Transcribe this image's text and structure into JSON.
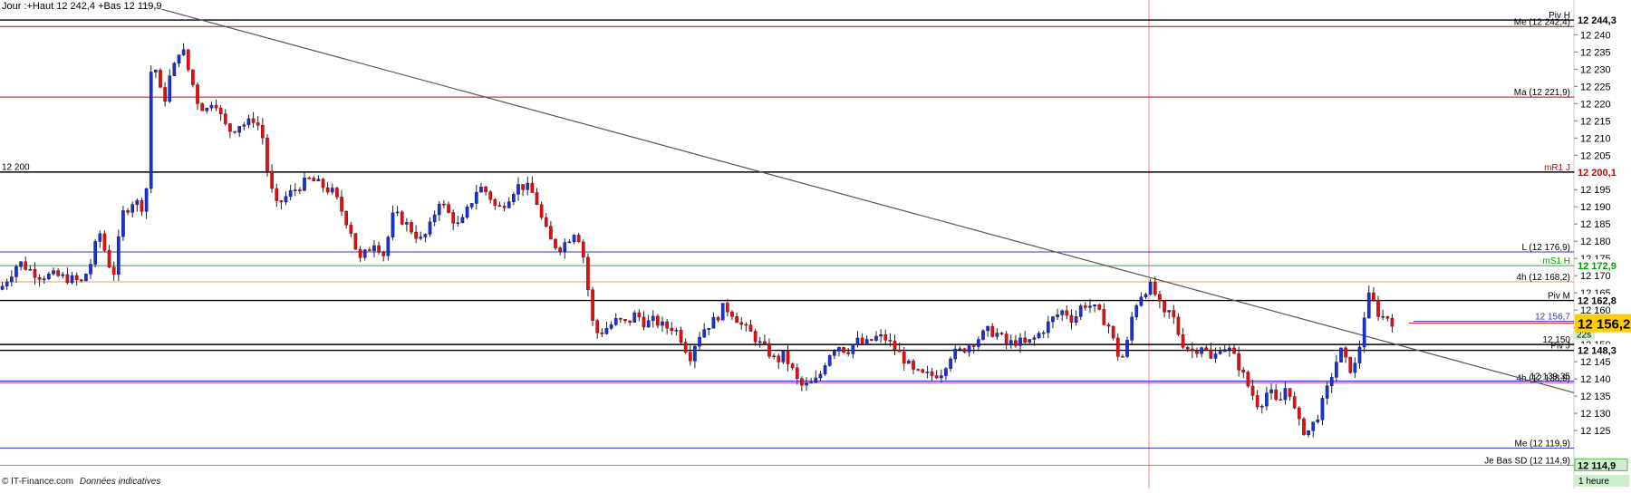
{
  "header": {
    "title": "Jour :+Haut 12 242,4 +Bas 12 119,9"
  },
  "footer": {
    "copyright": "© IT-Finance.com",
    "note": "Données indicatives"
  },
  "chart_data": {
    "type": "candlestick",
    "interval_label": "1 heure",
    "ylim": [
      12110,
      12248
    ],
    "yticks": [
      12125,
      12130,
      12135,
      12140,
      12145,
      12150,
      12155,
      12160,
      12165,
      12170,
      12175,
      12180,
      12185,
      12190,
      12195,
      12200,
      12205,
      12210,
      12215,
      12220,
      12225,
      12230,
      12235,
      12240
    ],
    "current_price": {
      "value": 12156.2,
      "label": "12 156,2"
    },
    "level_lines": [
      {
        "name": "Piv H",
        "value": 12244.3,
        "label": "Piv H",
        "price_label": "12 244,3",
        "color": "#000000",
        "label_color": "#000000",
        "tag_bg": ""
      },
      {
        "name": "Me",
        "value": 12242.4,
        "label": "Me (12 242,4)",
        "price_label": "",
        "color": "#cc0000",
        "label_color": "#000000",
        "tag_bg": ""
      },
      {
        "name": "Ma",
        "value": 12221.9,
        "label": "Ma (12 221,9)",
        "price_label": "",
        "color": "#cc0000",
        "label_color": "#000000",
        "tag_bg": ""
      },
      {
        "name": "mR1 J",
        "value": 12200.1,
        "label": "mR1 J",
        "price_label": "12 200,1",
        "color": "#000000",
        "label_color": "#cc0000",
        "tag_bg": ""
      },
      {
        "name": "L",
        "value": 12176.9,
        "label": "L (12 176,9)",
        "price_label": "",
        "color": "#3333cc",
        "label_color": "#000000",
        "tag_bg": ""
      },
      {
        "name": "mS1 H",
        "value": 12172.9,
        "label": "mS1 H",
        "price_label": "12 172,9",
        "color": "#33aa33",
        "label_color": "#009900",
        "tag_bg": ""
      },
      {
        "name": "4h",
        "value": 12168.2,
        "label": "4h (12 168,2)",
        "price_label": "",
        "color": "#e89a6a",
        "label_color": "#000000",
        "tag_bg": ""
      },
      {
        "name": "Piv M",
        "value": 12162.8,
        "label": "Piv M",
        "price_label": "12 162,8",
        "color": "#000000",
        "label_color": "#000000",
        "tag_bg": ""
      },
      {
        "name": "12 150",
        "value": 12150,
        "label": "12 150",
        "price_label": "",
        "color": "#000000",
        "label_color": "#000000",
        "tag_bg": ""
      },
      {
        "name": "Piv J",
        "value": 12148.3,
        "label": "Piv J",
        "price_label": "12 148,3",
        "color": "#000000",
        "label_color": "#000000",
        "tag_bg": ""
      },
      {
        "name": "12 139,35",
        "value": 12139.35,
        "label": "12 139,35",
        "price_label": "",
        "color": "#3333cc",
        "label_color": "#000000",
        "tag_bg": ""
      },
      {
        "name": "4h low",
        "value": 12138.9,
        "label": "4h (12 138,9)",
        "price_label": "",
        "color": "#cc3399",
        "label_color": "#000000",
        "tag_bg": ""
      },
      {
        "name": "Me low",
        "value": 12119.9,
        "label": "Me (12 119,9)",
        "price_label": "",
        "color": "#3333cc",
        "label_color": "#000000",
        "tag_bg": ""
      },
      {
        "name": "Je Bas SD",
        "value": 12114.9,
        "label": "Je Bas SD (12 114,9)",
        "price_label": "12 114,9",
        "color": "#55bb55",
        "label_color": "#000000",
        "tag_bg": "#cceecc"
      }
    ],
    "extra_labels": [
      {
        "value": 12200.0,
        "label": "12 200"
      },
      {
        "value": 12156.7,
        "label": "12 156,7"
      },
      {
        "value": 12153,
        "label": "22s"
      }
    ],
    "trendline": {
      "from": {
        "x": 0.09,
        "y": 12249
      },
      "to": {
        "x": 1.0,
        "y": 12136
      }
    },
    "crosshair_x": 0.73,
    "price_path": [
      [
        0.0,
        12166
      ],
      [
        0.006,
        12170
      ],
      [
        0.012,
        12174
      ],
      [
        0.018,
        12172
      ],
      [
        0.025,
        12170
      ],
      [
        0.035,
        12170
      ],
      [
        0.045,
        12169
      ],
      [
        0.052,
        12168
      ],
      [
        0.058,
        12174
      ],
      [
        0.063,
        12183
      ],
      [
        0.068,
        12175
      ],
      [
        0.072,
        12170
      ],
      [
        0.078,
        12188
      ],
      [
        0.085,
        12192
      ],
      [
        0.09,
        12190
      ],
      [
        0.093,
        12195
      ],
      [
        0.095,
        12228
      ],
      [
        0.098,
        12232
      ],
      [
        0.101,
        12225
      ],
      [
        0.104,
        12220
      ],
      [
        0.108,
        12228
      ],
      [
        0.112,
        12232
      ],
      [
        0.115,
        12238
      ],
      [
        0.118,
        12232
      ],
      [
        0.121,
        12228
      ],
      [
        0.126,
        12220
      ],
      [
        0.131,
        12218
      ],
      [
        0.136,
        12222
      ],
      [
        0.142,
        12214
      ],
      [
        0.147,
        12212
      ],
      [
        0.152,
        12214
      ],
      [
        0.157,
        12214
      ],
      [
        0.162,
        12216
      ],
      [
        0.167,
        12210
      ],
      [
        0.17,
        12200
      ],
      [
        0.175,
        12190
      ],
      [
        0.182,
        12193
      ],
      [
        0.19,
        12196
      ],
      [
        0.197,
        12198
      ],
      [
        0.205,
        12196
      ],
      [
        0.212,
        12194
      ],
      [
        0.218,
        12188
      ],
      [
        0.224,
        12182
      ],
      [
        0.228,
        12174
      ],
      [
        0.233,
        12177
      ],
      [
        0.238,
        12180
      ],
      [
        0.244,
        12176
      ],
      [
        0.25,
        12188
      ],
      [
        0.256,
        12186
      ],
      [
        0.262,
        12183
      ],
      [
        0.268,
        12180
      ],
      [
        0.273,
        12184
      ],
      [
        0.279,
        12192
      ],
      [
        0.285,
        12188
      ],
      [
        0.292,
        12184
      ],
      [
        0.298,
        12190
      ],
      [
        0.304,
        12196
      ],
      [
        0.31,
        12194
      ],
      [
        0.316,
        12189
      ],
      [
        0.322,
        12192
      ],
      [
        0.328,
        12196
      ],
      [
        0.334,
        12196
      ],
      [
        0.34,
        12193
      ],
      [
        0.345,
        12185
      ],
      [
        0.35,
        12180
      ],
      [
        0.355,
        12178
      ],
      [
        0.36,
        12180
      ],
      [
        0.365,
        12183
      ],
      [
        0.369,
        12180
      ],
      [
        0.372,
        12172
      ],
      [
        0.376,
        12157
      ],
      [
        0.38,
        12153
      ],
      [
        0.386,
        12155
      ],
      [
        0.392,
        12157
      ],
      [
        0.398,
        12156
      ],
      [
        0.404,
        12159
      ],
      [
        0.41,
        12156
      ],
      [
        0.416,
        12157
      ],
      [
        0.422,
        12155
      ],
      [
        0.428,
        12155
      ],
      [
        0.434,
        12151
      ],
      [
        0.438,
        12146
      ],
      [
        0.443,
        12152
      ],
      [
        0.448,
        12155
      ],
      [
        0.454,
        12157
      ],
      [
        0.46,
        12161
      ],
      [
        0.466,
        12159
      ],
      [
        0.472,
        12155
      ],
      [
        0.478,
        12153
      ],
      [
        0.483,
        12150
      ],
      [
        0.488,
        12148
      ],
      [
        0.493,
        12145
      ],
      [
        0.498,
        12147
      ],
      [
        0.503,
        12143
      ],
      [
        0.508,
        12138
      ],
      [
        0.514,
        12138
      ],
      [
        0.52,
        12140
      ],
      [
        0.526,
        12147
      ],
      [
        0.532,
        12150
      ],
      [
        0.538,
        12148
      ],
      [
        0.544,
        12151
      ],
      [
        0.55,
        12150
      ],
      [
        0.556,
        12152
      ],
      [
        0.562,
        12152
      ],
      [
        0.568,
        12149
      ],
      [
        0.574,
        12146
      ],
      [
        0.58,
        12142
      ],
      [
        0.586,
        12141
      ],
      [
        0.592,
        12141
      ],
      [
        0.598,
        12142
      ],
      [
        0.604,
        12147
      ],
      [
        0.61,
        12148
      ],
      [
        0.616,
        12150
      ],
      [
        0.622,
        12152
      ],
      [
        0.628,
        12154
      ],
      [
        0.634,
        12153
      ],
      [
        0.64,
        12150
      ],
      [
        0.646,
        12151
      ],
      [
        0.652,
        12150
      ],
      [
        0.658,
        12152
      ],
      [
        0.664,
        12155
      ],
      [
        0.67,
        12158
      ],
      [
        0.676,
        12160
      ],
      [
        0.682,
        12157
      ],
      [
        0.688,
        12162
      ],
      [
        0.694,
        12161
      ],
      [
        0.7,
        12158
      ],
      [
        0.705,
        12155
      ],
      [
        0.708,
        12150
      ],
      [
        0.712,
        12145
      ],
      [
        0.716,
        12150
      ],
      [
        0.72,
        12160
      ],
      [
        0.724,
        12164
      ],
      [
        0.728,
        12166
      ],
      [
        0.732,
        12167
      ],
      [
        0.736,
        12162
      ],
      [
        0.74,
        12158
      ],
      [
        0.744,
        12160
      ],
      [
        0.748,
        12154
      ],
      [
        0.752,
        12150
      ],
      [
        0.758,
        12148
      ],
      [
        0.764,
        12150
      ],
      [
        0.77,
        12145
      ],
      [
        0.776,
        12150
      ],
      [
        0.782,
        12148
      ],
      [
        0.788,
        12143
      ],
      [
        0.794,
        12137
      ],
      [
        0.8,
        12132
      ],
      [
        0.806,
        12137
      ],
      [
        0.812,
        12132
      ],
      [
        0.818,
        12139
      ],
      [
        0.824,
        12128
      ],
      [
        0.83,
        12124
      ],
      [
        0.836,
        12128
      ],
      [
        0.842,
        12135
      ],
      [
        0.848,
        12144
      ],
      [
        0.852,
        12148
      ],
      [
        0.856,
        12144
      ],
      [
        0.86,
        12142
      ],
      [
        0.864,
        12150
      ],
      [
        0.868,
        12162
      ],
      [
        0.871,
        12165
      ],
      [
        0.874,
        12160
      ],
      [
        0.878,
        12158
      ],
      [
        0.882,
        12158
      ],
      [
        0.886,
        12156
      ]
    ]
  }
}
